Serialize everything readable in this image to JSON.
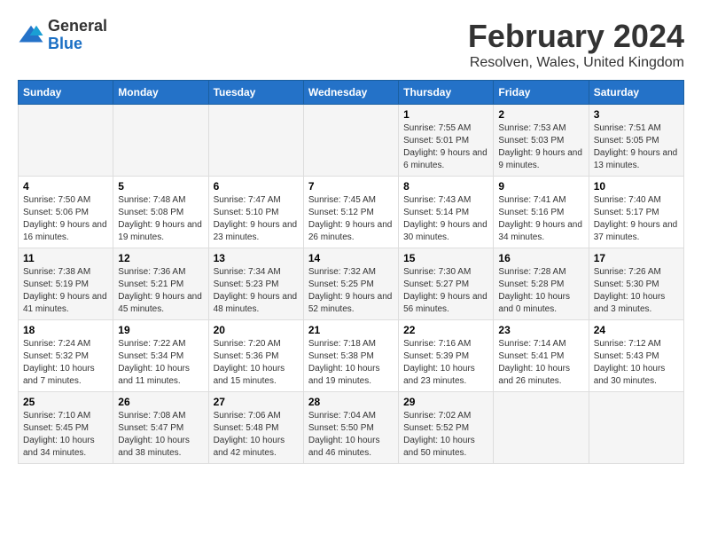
{
  "logo": {
    "general": "General",
    "blue": "Blue"
  },
  "title": "February 2024",
  "subtitle": "Resolven, Wales, United Kingdom",
  "days_of_week": [
    "Sunday",
    "Monday",
    "Tuesday",
    "Wednesday",
    "Thursday",
    "Friday",
    "Saturday"
  ],
  "weeks": [
    [
      {
        "day": "",
        "info": ""
      },
      {
        "day": "",
        "info": ""
      },
      {
        "day": "",
        "info": ""
      },
      {
        "day": "",
        "info": ""
      },
      {
        "day": "1",
        "info": "Sunrise: 7:55 AM\nSunset: 5:01 PM\nDaylight: 9 hours and 6 minutes."
      },
      {
        "day": "2",
        "info": "Sunrise: 7:53 AM\nSunset: 5:03 PM\nDaylight: 9 hours and 9 minutes."
      },
      {
        "day": "3",
        "info": "Sunrise: 7:51 AM\nSunset: 5:05 PM\nDaylight: 9 hours and 13 minutes."
      }
    ],
    [
      {
        "day": "4",
        "info": "Sunrise: 7:50 AM\nSunset: 5:06 PM\nDaylight: 9 hours and 16 minutes."
      },
      {
        "day": "5",
        "info": "Sunrise: 7:48 AM\nSunset: 5:08 PM\nDaylight: 9 hours and 19 minutes."
      },
      {
        "day": "6",
        "info": "Sunrise: 7:47 AM\nSunset: 5:10 PM\nDaylight: 9 hours and 23 minutes."
      },
      {
        "day": "7",
        "info": "Sunrise: 7:45 AM\nSunset: 5:12 PM\nDaylight: 9 hours and 26 minutes."
      },
      {
        "day": "8",
        "info": "Sunrise: 7:43 AM\nSunset: 5:14 PM\nDaylight: 9 hours and 30 minutes."
      },
      {
        "day": "9",
        "info": "Sunrise: 7:41 AM\nSunset: 5:16 PM\nDaylight: 9 hours and 34 minutes."
      },
      {
        "day": "10",
        "info": "Sunrise: 7:40 AM\nSunset: 5:17 PM\nDaylight: 9 hours and 37 minutes."
      }
    ],
    [
      {
        "day": "11",
        "info": "Sunrise: 7:38 AM\nSunset: 5:19 PM\nDaylight: 9 hours and 41 minutes."
      },
      {
        "day": "12",
        "info": "Sunrise: 7:36 AM\nSunset: 5:21 PM\nDaylight: 9 hours and 45 minutes."
      },
      {
        "day": "13",
        "info": "Sunrise: 7:34 AM\nSunset: 5:23 PM\nDaylight: 9 hours and 48 minutes."
      },
      {
        "day": "14",
        "info": "Sunrise: 7:32 AM\nSunset: 5:25 PM\nDaylight: 9 hours and 52 minutes."
      },
      {
        "day": "15",
        "info": "Sunrise: 7:30 AM\nSunset: 5:27 PM\nDaylight: 9 hours and 56 minutes."
      },
      {
        "day": "16",
        "info": "Sunrise: 7:28 AM\nSunset: 5:28 PM\nDaylight: 10 hours and 0 minutes."
      },
      {
        "day": "17",
        "info": "Sunrise: 7:26 AM\nSunset: 5:30 PM\nDaylight: 10 hours and 3 minutes."
      }
    ],
    [
      {
        "day": "18",
        "info": "Sunrise: 7:24 AM\nSunset: 5:32 PM\nDaylight: 10 hours and 7 minutes."
      },
      {
        "day": "19",
        "info": "Sunrise: 7:22 AM\nSunset: 5:34 PM\nDaylight: 10 hours and 11 minutes."
      },
      {
        "day": "20",
        "info": "Sunrise: 7:20 AM\nSunset: 5:36 PM\nDaylight: 10 hours and 15 minutes."
      },
      {
        "day": "21",
        "info": "Sunrise: 7:18 AM\nSunset: 5:38 PM\nDaylight: 10 hours and 19 minutes."
      },
      {
        "day": "22",
        "info": "Sunrise: 7:16 AM\nSunset: 5:39 PM\nDaylight: 10 hours and 23 minutes."
      },
      {
        "day": "23",
        "info": "Sunrise: 7:14 AM\nSunset: 5:41 PM\nDaylight: 10 hours and 26 minutes."
      },
      {
        "day": "24",
        "info": "Sunrise: 7:12 AM\nSunset: 5:43 PM\nDaylight: 10 hours and 30 minutes."
      }
    ],
    [
      {
        "day": "25",
        "info": "Sunrise: 7:10 AM\nSunset: 5:45 PM\nDaylight: 10 hours and 34 minutes."
      },
      {
        "day": "26",
        "info": "Sunrise: 7:08 AM\nSunset: 5:47 PM\nDaylight: 10 hours and 38 minutes."
      },
      {
        "day": "27",
        "info": "Sunrise: 7:06 AM\nSunset: 5:48 PM\nDaylight: 10 hours and 42 minutes."
      },
      {
        "day": "28",
        "info": "Sunrise: 7:04 AM\nSunset: 5:50 PM\nDaylight: 10 hours and 46 minutes."
      },
      {
        "day": "29",
        "info": "Sunrise: 7:02 AM\nSunset: 5:52 PM\nDaylight: 10 hours and 50 minutes."
      },
      {
        "day": "",
        "info": ""
      },
      {
        "day": "",
        "info": ""
      }
    ]
  ]
}
